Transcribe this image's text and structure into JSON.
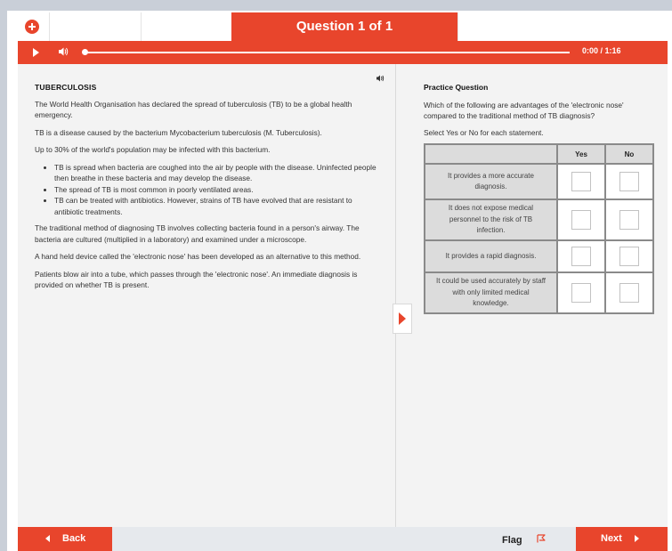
{
  "header": {
    "title": "Question 1 of 1",
    "zoom_icon": "zoom-in-icon"
  },
  "audio": {
    "play_icon": "play-icon",
    "volume_icon": "volume-icon",
    "time": "0:00  /  1:16",
    "progress": 0
  },
  "passage": {
    "heading": "TUBERCULOSIS",
    "p1": "The World Health Organisation has declared the spread of tuberculosis (TB) to be a global health emergency.",
    "p2": "TB is a disease caused by the bacterium Mycobacterium tuberculosis (M. Tuberculosis).",
    "p3": "Up to 30% of the world's population may be infected with this bacterium.",
    "bullets": [
      "TB is spread when bacteria are coughed into the air by people with the disease. Uninfected people then breathe in these bacteria and may develop the disease.",
      "The spread of TB is most common in poorly ventilated areas.",
      "TB can be treated with antibiotics. However, strains of TB have evolved that are resistant to antibiotic treatments."
    ],
    "p4": "The traditional method of diagnosing TB involves collecting bacteria found in a person's airway. The bacteria are cultured (multiplied in a laboratory) and examined under a microscope.",
    "p5": "A hand held device called the 'electronic nose' has been developed as an alternative to this method.",
    "p6": "Patients blow air into a tube, which passes through the 'electronic nose'. An immediate diagnosis is provided on whether TB is present."
  },
  "question": {
    "title": "Practice Question",
    "prompt": "Which of the following are advantages of the 'electronic nose' compared to the traditional method of TB diagnosis?",
    "instruction": "Select Yes or No for each statement.",
    "col_yes": "Yes",
    "col_no": "No",
    "statements": [
      "It provides a more accurate diagnosis.",
      "It does not expose medical personnel to the risk of TB infection.",
      "It provides a rapid diagnosis.",
      "It could be used accurately by staff with only limited medical knowledge."
    ]
  },
  "footer": {
    "back": "Back",
    "flag": "Flag",
    "next": "Next"
  },
  "colors": {
    "accent": "#e8452c",
    "panel": "#f3f3f3",
    "table_header": "#dcdcdc"
  }
}
